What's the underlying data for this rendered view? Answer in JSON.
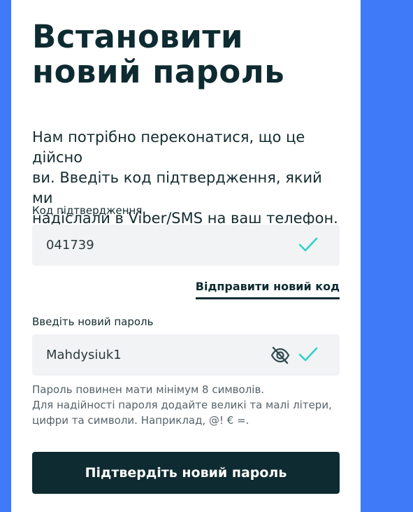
{
  "page": {
    "title_line1": "Встановити",
    "title_line2": "новий пароль",
    "intro_line1": "Нам потрібно переконатися, що це дійсно",
    "intro_line2": "ви. Введіть код підтвердження, який ми",
    "intro_line3": "надіслали в Viber/SMS на ваш телефон."
  },
  "code_field": {
    "label": "Код підтвердження",
    "value": "041739",
    "status_icon": "check-icon"
  },
  "resend_link": "Відправити новий код",
  "password_field": {
    "label": "Введіть новий пароль",
    "value": "Mahdysiuk1",
    "visibility_icon": "eye-off-icon",
    "status_icon": "check-icon"
  },
  "hint": {
    "line1": "Пароль повинен мати мінімум 8 символів.",
    "line2": "Для надійності пароля додайте великі та малі літери,",
    "line3": "цифри та символи. Наприклад, @! € =."
  },
  "submit_button": "Підтвердіть новий пароль",
  "colors": {
    "accent_blue": "#3f7bf9",
    "dark_teal": "#0d2b30",
    "check_teal": "#2ed3c6",
    "field_bg": "#f2f3f5"
  }
}
